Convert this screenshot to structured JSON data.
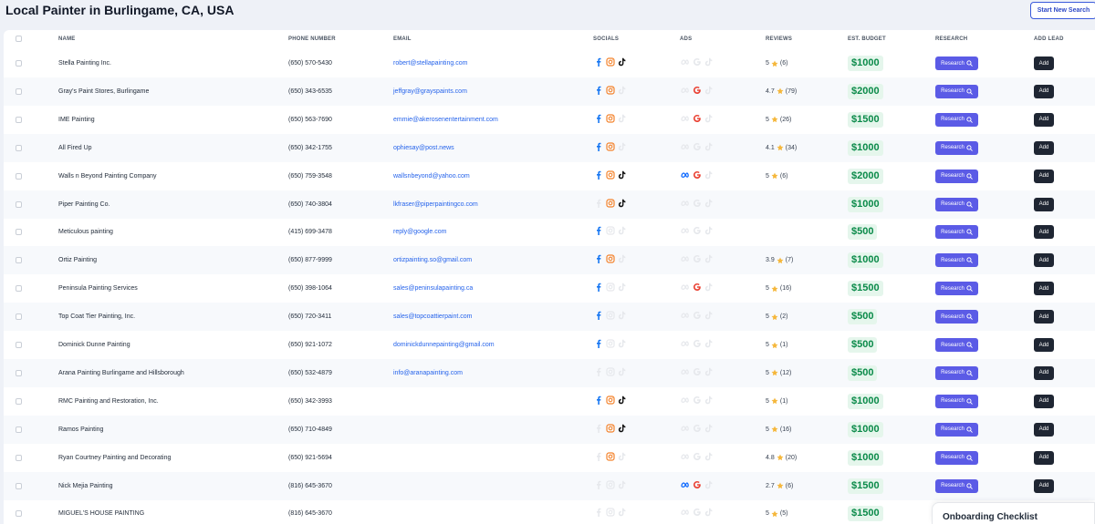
{
  "page": {
    "title": "Local Painter in Burlingame, CA, USA",
    "new_search_label": "Start New Search"
  },
  "table": {
    "columns": {
      "name": "NAME",
      "phone": "PHONE NUMBER",
      "email": "EMAIL",
      "socials": "SOCIALS",
      "ads": "ADS",
      "reviews": "REVIEWS",
      "budget": "EST. BUDGET",
      "research": "RESEARCH",
      "add_lead": "ADD LEAD"
    },
    "research_label": "Research",
    "add_label": "Add",
    "rows": [
      {
        "name": "Stella Painting Inc.",
        "phone": "(650) 570-5430",
        "email": "robert@stellapainting.com",
        "facebook": true,
        "instagram": true,
        "tiktok": true,
        "meta_ads": false,
        "google_ads": false,
        "tiktok_ads": false,
        "rating": "5",
        "review_count": "(6)",
        "budget": "$1000"
      },
      {
        "name": "Gray's Paint Stores, Burlingame",
        "phone": "(650) 343-6535",
        "email": "jeffgray@grayspaints.com",
        "facebook": true,
        "instagram": true,
        "tiktok": false,
        "meta_ads": false,
        "google_ads": true,
        "tiktok_ads": false,
        "rating": "4.7",
        "review_count": "(79)",
        "budget": "$2000"
      },
      {
        "name": "IME Painting",
        "phone": "(650) 563-7690",
        "email": "emmie@akerosenentertainment.com",
        "facebook": true,
        "instagram": true,
        "tiktok": false,
        "meta_ads": false,
        "google_ads": true,
        "tiktok_ads": false,
        "rating": "5",
        "review_count": "(26)",
        "budget": "$1500"
      },
      {
        "name": "All Fired Up",
        "phone": "(650) 342-1755",
        "email": "ophiesay@post.news",
        "facebook": true,
        "instagram": true,
        "tiktok": false,
        "meta_ads": false,
        "google_ads": false,
        "tiktok_ads": false,
        "rating": "4.1",
        "review_count": "(34)",
        "budget": "$1000"
      },
      {
        "name": "Walls n Beyond Painting Company",
        "phone": "(650) 759-3548",
        "email": "wallsnbeyond@yahoo.com",
        "facebook": true,
        "instagram": true,
        "tiktok": true,
        "meta_ads": true,
        "google_ads": true,
        "tiktok_ads": false,
        "rating": "5",
        "review_count": "(6)",
        "budget": "$2000"
      },
      {
        "name": "Piper Painting Co.",
        "phone": "(650) 740-3804",
        "email": "lkfraser@piperpaintingco.com",
        "facebook": false,
        "instagram": true,
        "tiktok": true,
        "meta_ads": false,
        "google_ads": false,
        "tiktok_ads": false,
        "rating": "",
        "review_count": "",
        "budget": "$1000"
      },
      {
        "name": "Meticulous painting",
        "phone": "(415) 699-3478",
        "email": "reply@google.com",
        "facebook": true,
        "instagram": false,
        "tiktok": false,
        "meta_ads": false,
        "google_ads": false,
        "tiktok_ads": false,
        "rating": "",
        "review_count": "",
        "budget": "$500"
      },
      {
        "name": "Ortiz Painting",
        "phone": "(650) 877-9999",
        "email": "ortizpainting.so@gmail.com",
        "facebook": true,
        "instagram": true,
        "tiktok": false,
        "meta_ads": false,
        "google_ads": false,
        "tiktok_ads": false,
        "rating": "3.9",
        "review_count": "(7)",
        "budget": "$1000"
      },
      {
        "name": "Peninsula Painting Services",
        "phone": "(650) 398-1064",
        "email": "sales@peninsulapainting.ca",
        "facebook": true,
        "instagram": false,
        "tiktok": false,
        "meta_ads": false,
        "google_ads": true,
        "tiktok_ads": false,
        "rating": "5",
        "review_count": "(16)",
        "budget": "$1500"
      },
      {
        "name": "Top Coat Tier Painting, Inc.",
        "phone": "(650) 720-3411",
        "email": "sales@topcoattierpaint.com",
        "facebook": true,
        "instagram": false,
        "tiktok": false,
        "meta_ads": false,
        "google_ads": false,
        "tiktok_ads": false,
        "rating": "5",
        "review_count": "(2)",
        "budget": "$500"
      },
      {
        "name": "Dominick Dunne Painting",
        "phone": "(650) 921-1072",
        "email": "dominickdunnepainting@gmail.com",
        "facebook": true,
        "instagram": false,
        "tiktok": false,
        "meta_ads": false,
        "google_ads": false,
        "tiktok_ads": false,
        "rating": "5",
        "review_count": "(1)",
        "budget": "$500"
      },
      {
        "name": "Arana Painting Burlingame and Hillsborough",
        "phone": "(650) 532-4879",
        "email": "info@aranapainting.com",
        "facebook": false,
        "instagram": false,
        "tiktok": false,
        "meta_ads": false,
        "google_ads": false,
        "tiktok_ads": false,
        "rating": "5",
        "review_count": "(12)",
        "budget": "$500"
      },
      {
        "name": "RMC Painting and Restoration, Inc.",
        "phone": "(650) 342-3993",
        "email": "",
        "facebook": true,
        "instagram": true,
        "tiktok": true,
        "meta_ads": false,
        "google_ads": false,
        "tiktok_ads": false,
        "rating": "5",
        "review_count": "(1)",
        "budget": "$1000"
      },
      {
        "name": "Ramos Painting",
        "phone": "(650) 710-4849",
        "email": "",
        "facebook": false,
        "instagram": true,
        "tiktok": true,
        "meta_ads": false,
        "google_ads": false,
        "tiktok_ads": false,
        "rating": "5",
        "review_count": "(16)",
        "budget": "$1000"
      },
      {
        "name": "Ryan Courtney Painting and Decorating",
        "phone": "(650) 921-5694",
        "email": "",
        "facebook": false,
        "instagram": true,
        "tiktok": false,
        "meta_ads": false,
        "google_ads": false,
        "tiktok_ads": false,
        "rating": "4.8",
        "review_count": "(20)",
        "budget": "$1000"
      },
      {
        "name": "Nick Mejia Painting",
        "phone": "(816) 645-3670",
        "email": "",
        "facebook": false,
        "instagram": false,
        "tiktok": false,
        "meta_ads": true,
        "google_ads": true,
        "tiktok_ads": false,
        "rating": "2.7",
        "review_count": "(6)",
        "budget": "$1500"
      },
      {
        "name": "MIGUEL'S HOUSE PAINTING",
        "phone": "(816) 645-3670",
        "email": "",
        "facebook": false,
        "instagram": false,
        "tiktok": false,
        "meta_ads": false,
        "google_ads": false,
        "tiktok_ads": false,
        "rating": "5",
        "review_count": "(5)",
        "budget": "$1500"
      }
    ]
  },
  "onboarding": {
    "label": "Onboarding Checklist"
  },
  "icons": {
    "facebook": "facebook-icon",
    "instagram": "instagram-icon",
    "tiktok": "tiktok-icon",
    "meta_ads": "meta-icon",
    "google_ads": "google-icon",
    "tiktok_ads": "tiktok-icon",
    "star": "star-icon",
    "search": "search-icon"
  },
  "colors": {
    "accent": "#5b5be6",
    "budget_text": "#0a8a49",
    "budget_bg": "#e5f6ec",
    "link": "#2563eb",
    "add_button": "#1f2633",
    "facebook": "#1877f2",
    "instagram": "#f4832c",
    "google_red": "#ea4335",
    "meta_blue": "#0866ff",
    "star": "#f5b73b",
    "icon_inactive": "#e6e8ec"
  }
}
